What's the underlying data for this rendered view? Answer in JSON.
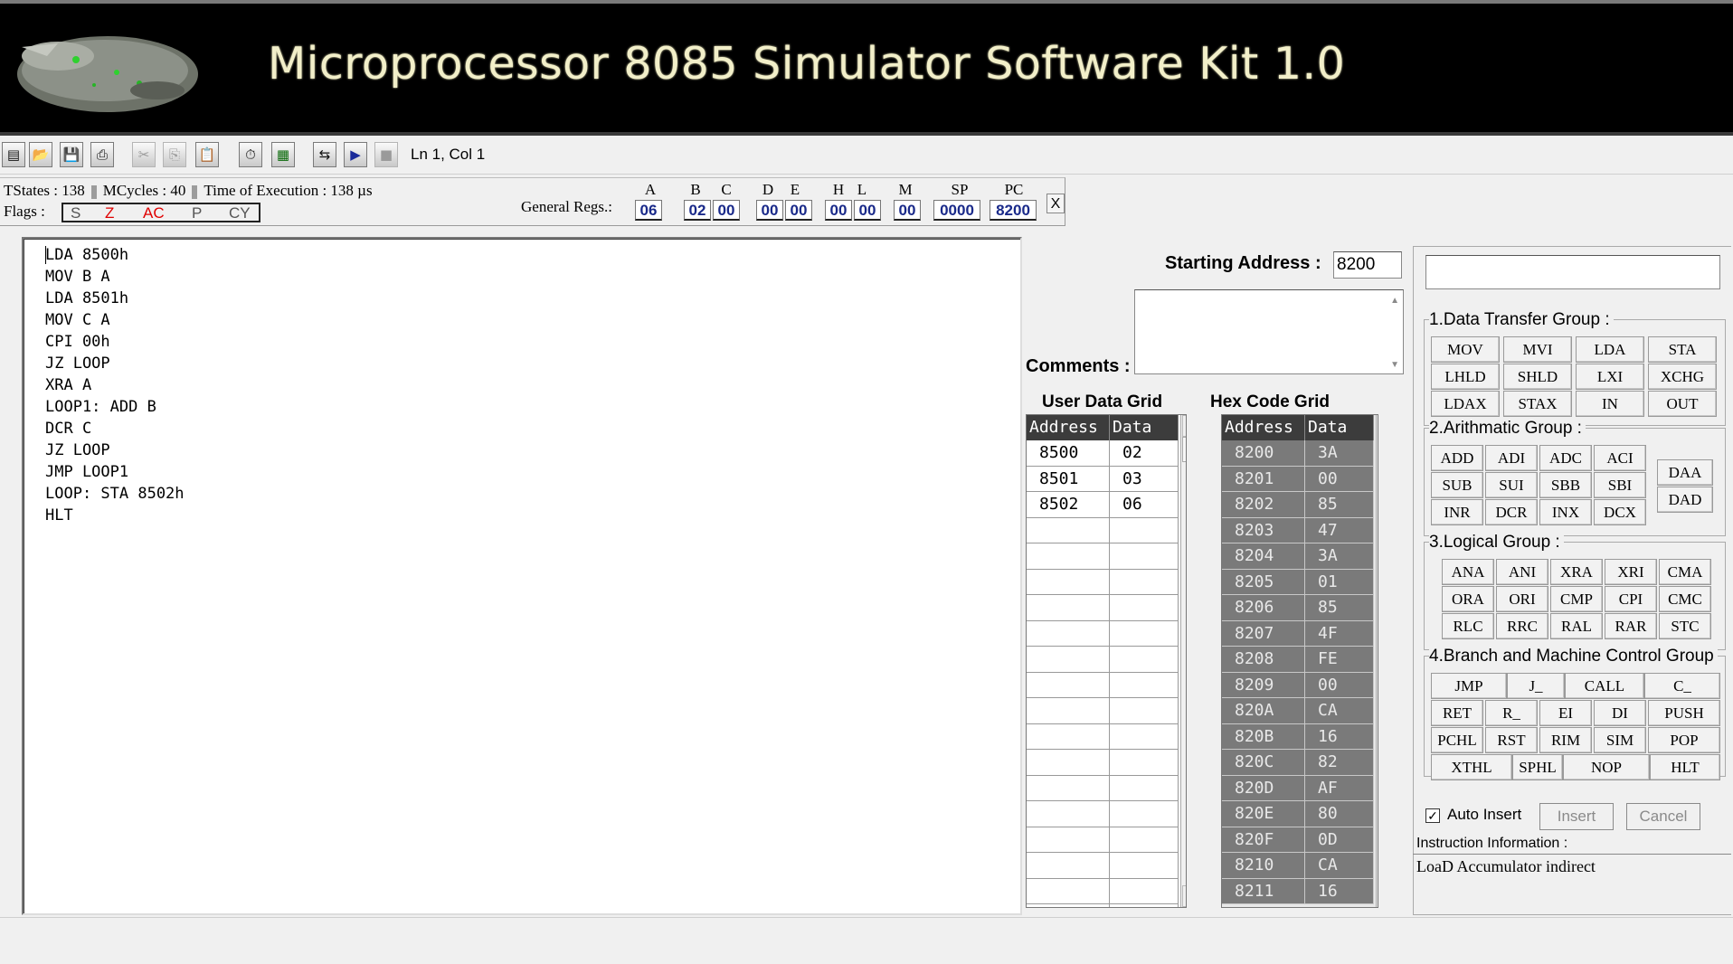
{
  "banner": {
    "title": "Microprocessor 8085 Simulator Software Kit 1.0"
  },
  "toolbar": {
    "buttons": [
      {
        "name": "new-icon",
        "glyph": "▤"
      },
      {
        "name": "open-icon",
        "glyph": "📂"
      },
      {
        "name": "save-icon",
        "glyph": "💾"
      },
      {
        "name": "print-icon",
        "glyph": "⎙"
      },
      {
        "name": "cut-icon",
        "glyph": "✂"
      },
      {
        "name": "copy-icon",
        "glyph": "⎘"
      },
      {
        "name": "paste-icon",
        "glyph": "📋"
      },
      {
        "name": "timer-icon",
        "glyph": "⏱"
      },
      {
        "name": "display-icon",
        "glyph": "▦"
      },
      {
        "name": "step-icon",
        "glyph": "⇆"
      },
      {
        "name": "run-icon",
        "glyph": "▶"
      },
      {
        "name": "stop-icon",
        "glyph": "■"
      }
    ],
    "position": "Ln 1, Col 1"
  },
  "status": {
    "tstates": "TStates : 138",
    "mcycles": "MCycles : 40",
    "exec_time": "Time of Execution : 138 µs",
    "flags_label": "Flags :",
    "flags": [
      {
        "name": "S",
        "active": false
      },
      {
        "name": "Z",
        "active": true
      },
      {
        "name": "AC",
        "active": true
      },
      {
        "name": "P",
        "active": false
      },
      {
        "name": "CY",
        "active": false
      }
    ],
    "general_regs_label": "General Regs.:",
    "registers": [
      {
        "name": "A",
        "value": "06"
      },
      {
        "name": "B",
        "value": "02"
      },
      {
        "name": "C",
        "value": "00"
      },
      {
        "name": "D",
        "value": "00"
      },
      {
        "name": "E",
        "value": "00"
      },
      {
        "name": "H",
        "value": "00"
      },
      {
        "name": "L",
        "value": "00"
      },
      {
        "name": "M",
        "value": "00"
      },
      {
        "name": "SP",
        "value": "0000"
      },
      {
        "name": "PC",
        "value": "8200"
      }
    ],
    "close_label": "X"
  },
  "editor": {
    "lines": [
      "LDA 8500h",
      "MOV B A",
      "LDA 8501h",
      "MOV C A",
      "CPI 00h",
      "JZ LOOP",
      "XRA A",
      "LOOP1: ADD B",
      "DCR C",
      "JZ LOOP",
      "JMP LOOP1",
      "LOOP: STA 8502h",
      "HLT"
    ]
  },
  "starting_address": {
    "label": "Starting Address :",
    "value": "8200"
  },
  "comments": {
    "label": "Comments :"
  },
  "user_grid": {
    "title": "User Data Grid",
    "headers": [
      "Address",
      "Data"
    ],
    "rows": [
      [
        "8500",
        "02"
      ],
      [
        "8501",
        "03"
      ],
      [
        "8502",
        "06"
      ],
      [
        "",
        ""
      ],
      [
        "",
        ""
      ],
      [
        "",
        ""
      ],
      [
        "",
        ""
      ],
      [
        "",
        ""
      ],
      [
        "",
        ""
      ],
      [
        "",
        ""
      ],
      [
        "",
        ""
      ],
      [
        "",
        ""
      ],
      [
        "",
        ""
      ],
      [
        "",
        ""
      ],
      [
        "",
        ""
      ],
      [
        "",
        ""
      ],
      [
        "",
        ""
      ],
      [
        "",
        ""
      ],
      [
        "",
        ""
      ]
    ]
  },
  "hex_grid": {
    "title": "Hex Code Grid",
    "headers": [
      "Address",
      "Data"
    ],
    "rows": [
      [
        "8200",
        "3A"
      ],
      [
        "8201",
        "00"
      ],
      [
        "8202",
        "85"
      ],
      [
        "8203",
        "47"
      ],
      [
        "8204",
        "3A"
      ],
      [
        "8205",
        "01"
      ],
      [
        "8206",
        "85"
      ],
      [
        "8207",
        "4F"
      ],
      [
        "8208",
        "FE"
      ],
      [
        "8209",
        "00"
      ],
      [
        "820A",
        "CA"
      ],
      [
        "820B",
        "16"
      ],
      [
        "820C",
        "82"
      ],
      [
        "820D",
        "AF"
      ],
      [
        "820E",
        "80"
      ],
      [
        "820F",
        "0D"
      ],
      [
        "8210",
        "CA"
      ],
      [
        "8211",
        "16"
      ]
    ]
  },
  "groups": [
    {
      "title": "1.Data Transfer Group :",
      "buttons": [
        "MOV",
        "MVI",
        "LDA",
        "STA",
        "LHLD",
        "SHLD",
        "LXI",
        "XCHG",
        "LDAX",
        "STAX",
        "IN",
        "OUT"
      ]
    },
    {
      "title": "2.Arithmatic Group :",
      "buttons": [
        "ADD",
        "ADI",
        "ADC",
        "ACI",
        "SUB",
        "SUI",
        "SBB",
        "SBI",
        "INR",
        "DCR",
        "INX",
        "DCX",
        "DAA",
        "DAD"
      ]
    },
    {
      "title": "3.Logical Group :",
      "buttons": [
        "ANA",
        "ANI",
        "XRA",
        "XRI",
        "CMA",
        "ORA",
        "ORI",
        "CMP",
        "CPI",
        "CMC",
        "RLC",
        "RRC",
        "RAL",
        "RAR",
        "STC"
      ]
    },
    {
      "title": "4.Branch and Machine Control Group",
      "buttons": [
        "JMP",
        "J_",
        "CALL",
        "C_",
        "RET",
        "R_",
        "EI",
        "DI",
        "PUSH",
        "PCHL",
        "RST",
        "RIM",
        "SIM",
        "POP",
        "XTHL",
        "SPHL",
        "NOP",
        "HLT"
      ]
    }
  ],
  "auto_insert": {
    "label": "Auto Insert",
    "checked": "✓"
  },
  "insert_label": "Insert",
  "cancel_label": "Cancel",
  "instruction_info": {
    "label": "Instruction Information :",
    "text": "LoaD Accumulator indirect"
  },
  "colors": {
    "flag_active": "#e00000",
    "register_value": "#1a2a8a",
    "hex_grid_bg": "#7a7a7a"
  }
}
